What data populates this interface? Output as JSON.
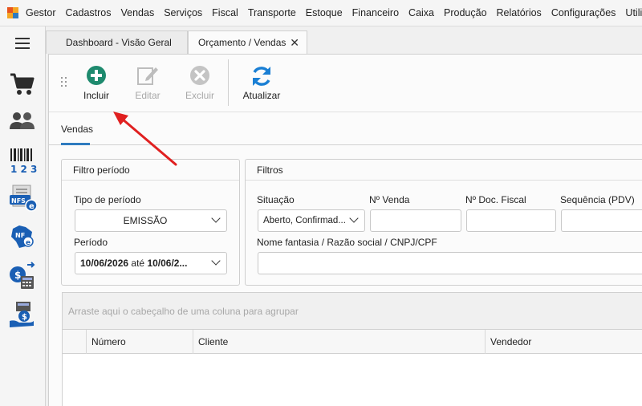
{
  "menubar": {
    "app_name": "Gestor",
    "items": [
      "Cadastros",
      "Vendas",
      "Serviços",
      "Fiscal",
      "Transporte",
      "Estoque",
      "Financeiro",
      "Caixa",
      "Produção",
      "Relatórios",
      "Configurações",
      "Utilitários"
    ]
  },
  "sidebar": {
    "icons": [
      "shopping-cart-icon",
      "users-icon",
      "barcode-icon",
      "nfse-icon",
      "nfe-icon",
      "cash-register-icon",
      "money-hand-icon"
    ]
  },
  "tabs": [
    {
      "label": "Dashboard - Visão Geral"
    },
    {
      "label": "Orçamento / Vendas",
      "close": "✕"
    }
  ],
  "toolbar": {
    "include_label": "Incluir",
    "edit_label": "Editar",
    "delete_label": "Excluir",
    "refresh_label": "Atualizar"
  },
  "subtabs": {
    "sales_label": "Vendas"
  },
  "period_filter": {
    "title": "Filtro período",
    "period_type_label": "Tipo de período",
    "period_type_value": "EMISSÃO",
    "period_label": "Período",
    "date_from": "10/06/2026",
    "date_to_connector": "até",
    "date_to": "10/06/2..."
  },
  "filters": {
    "title": "Filtros",
    "status_label": "Situação",
    "status_value": "Aberto, Confirmad...",
    "sale_number_label": "Nº Venda",
    "fiscal_doc_label": "Nº Doc. Fiscal",
    "sequence_label": "Sequência (PDV)",
    "name_label": "Nome fantasia / Razão social / CNPJ/CPF"
  },
  "grid": {
    "group_hint": "Arraste aqui o cabeçalho de uma coluna para agrupar",
    "columns": [
      "Número",
      "Cliente",
      "Vendedor"
    ]
  },
  "colors": {
    "accent": "#2f7bbf",
    "include_green": "#1e8a6e",
    "refresh_blue": "#1a7fd4",
    "arrow_red": "#e02020"
  }
}
